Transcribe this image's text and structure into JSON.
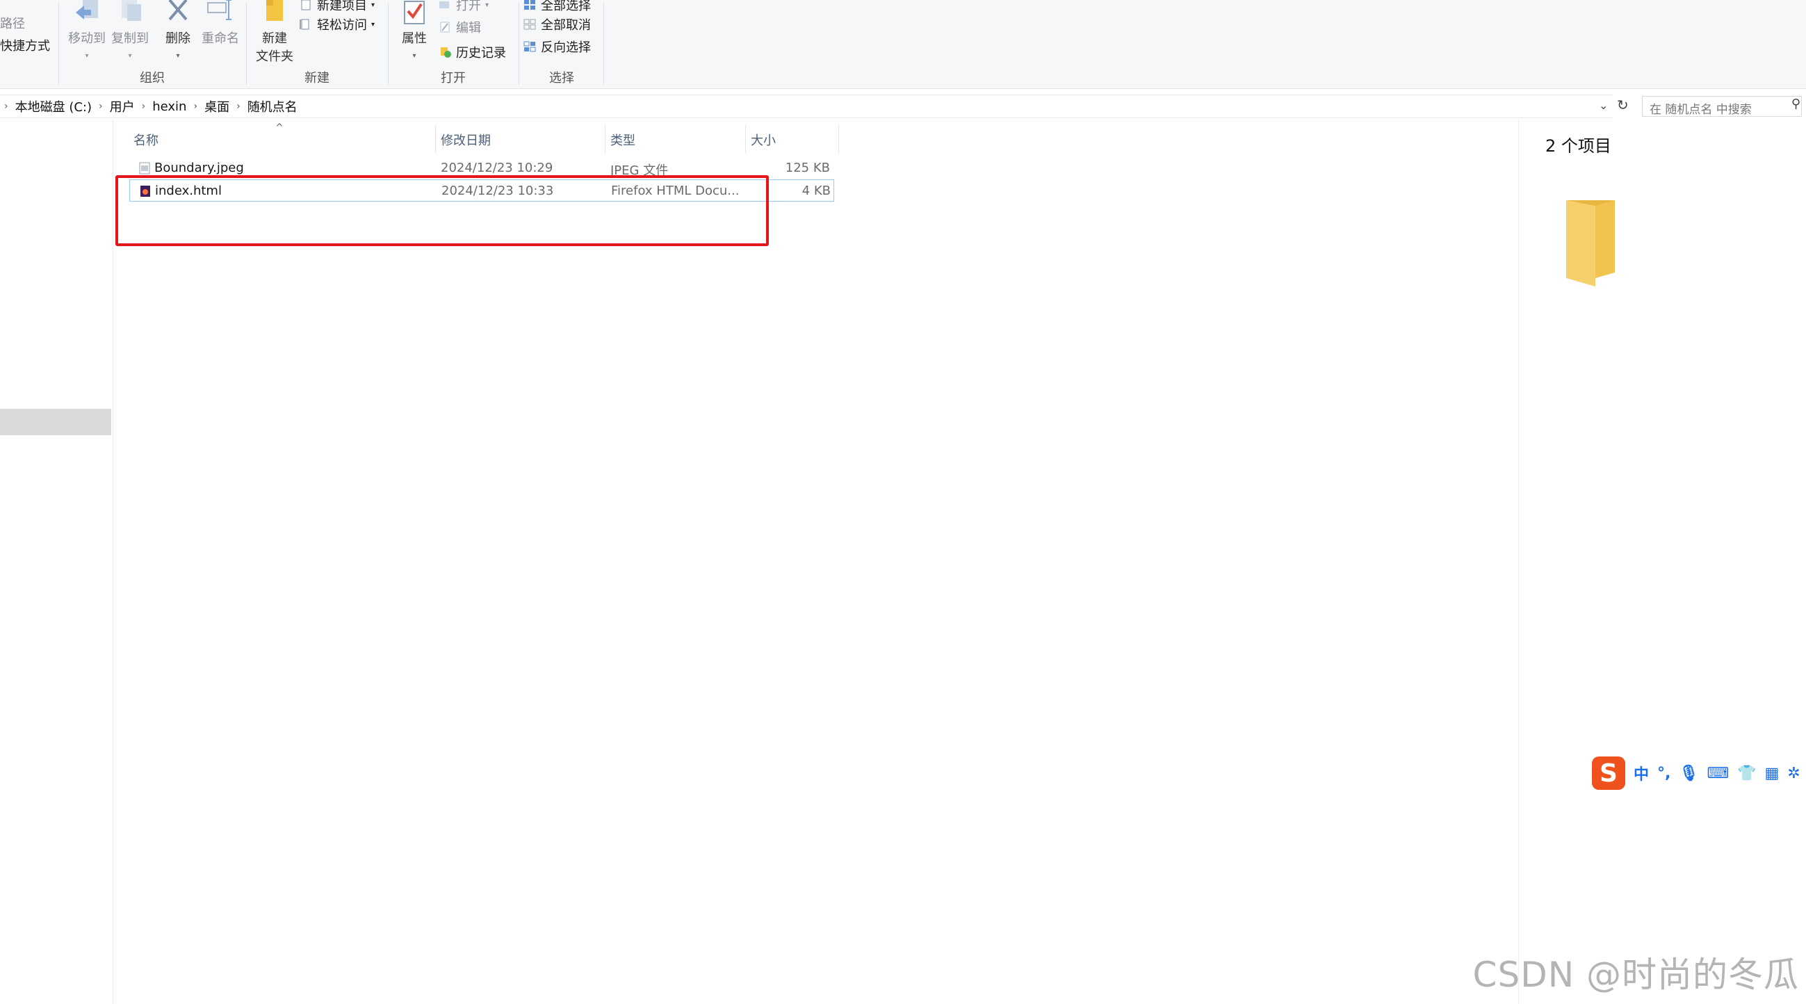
{
  "ribbon": {
    "copy_path": "路径",
    "paste_shortcut": "快捷方式",
    "organize": {
      "label": "组织",
      "move_to": "移动到",
      "copy_to": "复制到",
      "delete": "删除",
      "rename": "重命名"
    },
    "new": {
      "label": "新建",
      "new_item": "新建项目",
      "easy_access": "轻松访问",
      "new_folder_line1": "新建",
      "new_folder_line2": "文件夹"
    },
    "open": {
      "label": "打开",
      "properties": "属性",
      "open": "打开",
      "edit": "编辑",
      "history": "历史记录"
    },
    "select": {
      "label": "选择",
      "select_all": "全部选择",
      "select_none": "全部取消",
      "invert": "反向选择"
    }
  },
  "address": {
    "crumbs": [
      "本地磁盘 (C:)",
      "用户",
      "hexin",
      "桌面",
      "随机点名"
    ],
    "search_placeholder": "在 随机点名 中搜索"
  },
  "columns": {
    "name": "名称",
    "date": "修改日期",
    "type": "类型",
    "size": "大小"
  },
  "files": [
    {
      "name": "Boundary.jpeg",
      "date": "2024/12/23 10:29",
      "type": "JPEG 文件",
      "size": "125 KB"
    },
    {
      "name": "index.html",
      "date": "2024/12/23 10:33",
      "type": "Firefox HTML Docu...",
      "size": "4 KB"
    }
  ],
  "details": {
    "count": "2 个项目"
  },
  "ime": {
    "logo": "S",
    "mode": "中",
    "punct": "°,"
  },
  "watermark": "CSDN @时尚的冬瓜",
  "colors": {
    "highlight_box": "#e3161c",
    "selection_border": "#99c9f7",
    "ime_logo": "#f0521d",
    "folder": "#f4c542"
  }
}
